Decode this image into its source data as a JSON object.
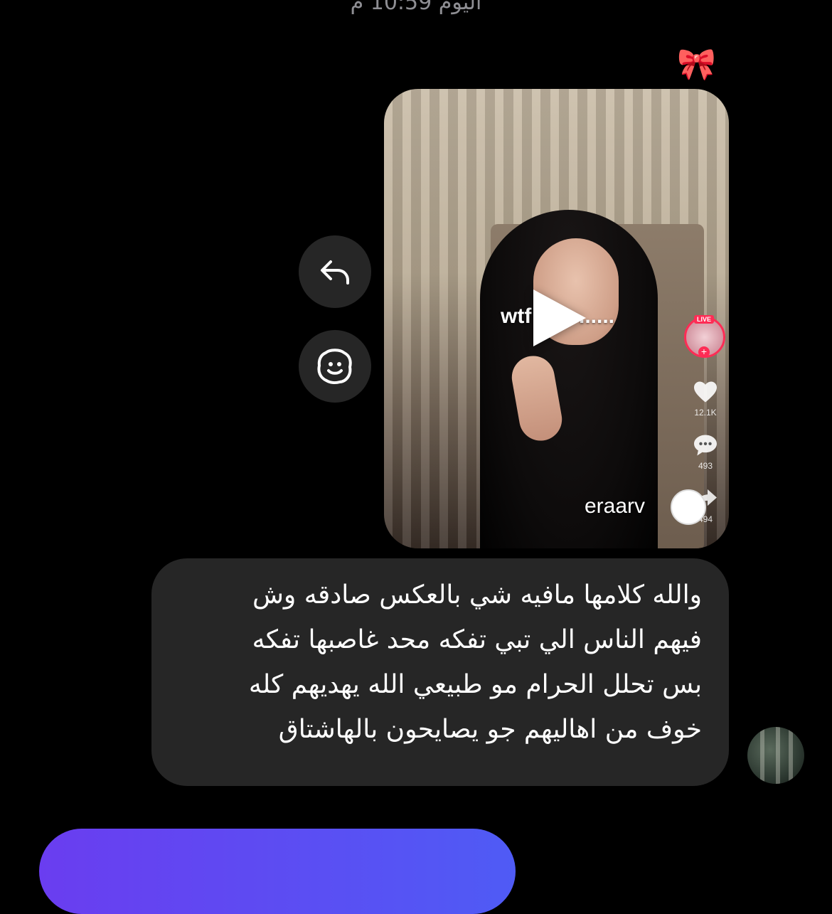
{
  "timestamp": "اليوم 10:59 م",
  "reaction": {
    "emoji": "🎀",
    "icon_name": "ribbon-bow-icon"
  },
  "shared_video": {
    "overlay_caption": "wtf        ......",
    "author": "eraarv",
    "author_avatar_emoji": "😈",
    "live_label": "LIVE",
    "likes": "12.1K",
    "comments": "493",
    "shares": "494"
  },
  "actions": {
    "reply_icon": "reply-arrow-icon",
    "react_icon": "smiley-face-icon"
  },
  "message": {
    "lines": [
      "والله كلامها مافيه شي بالعكس صادقه وش",
      "فيهم الناس الي تبي تفكه محد غاصبها تفكه",
      "بس تحلل الحرام مو طبيعي الله يهديهم كله",
      "خوف من اهاليهم جو يصايحون بالهاشتاق"
    ]
  },
  "colors": {
    "background": "#000000",
    "bubble": "#262626",
    "timestamp": "#8e8e93",
    "accent_live": "#fe2c55",
    "outgoing_bubble_start": "#6a3df0",
    "outgoing_bubble_end": "#4f5bf5"
  }
}
